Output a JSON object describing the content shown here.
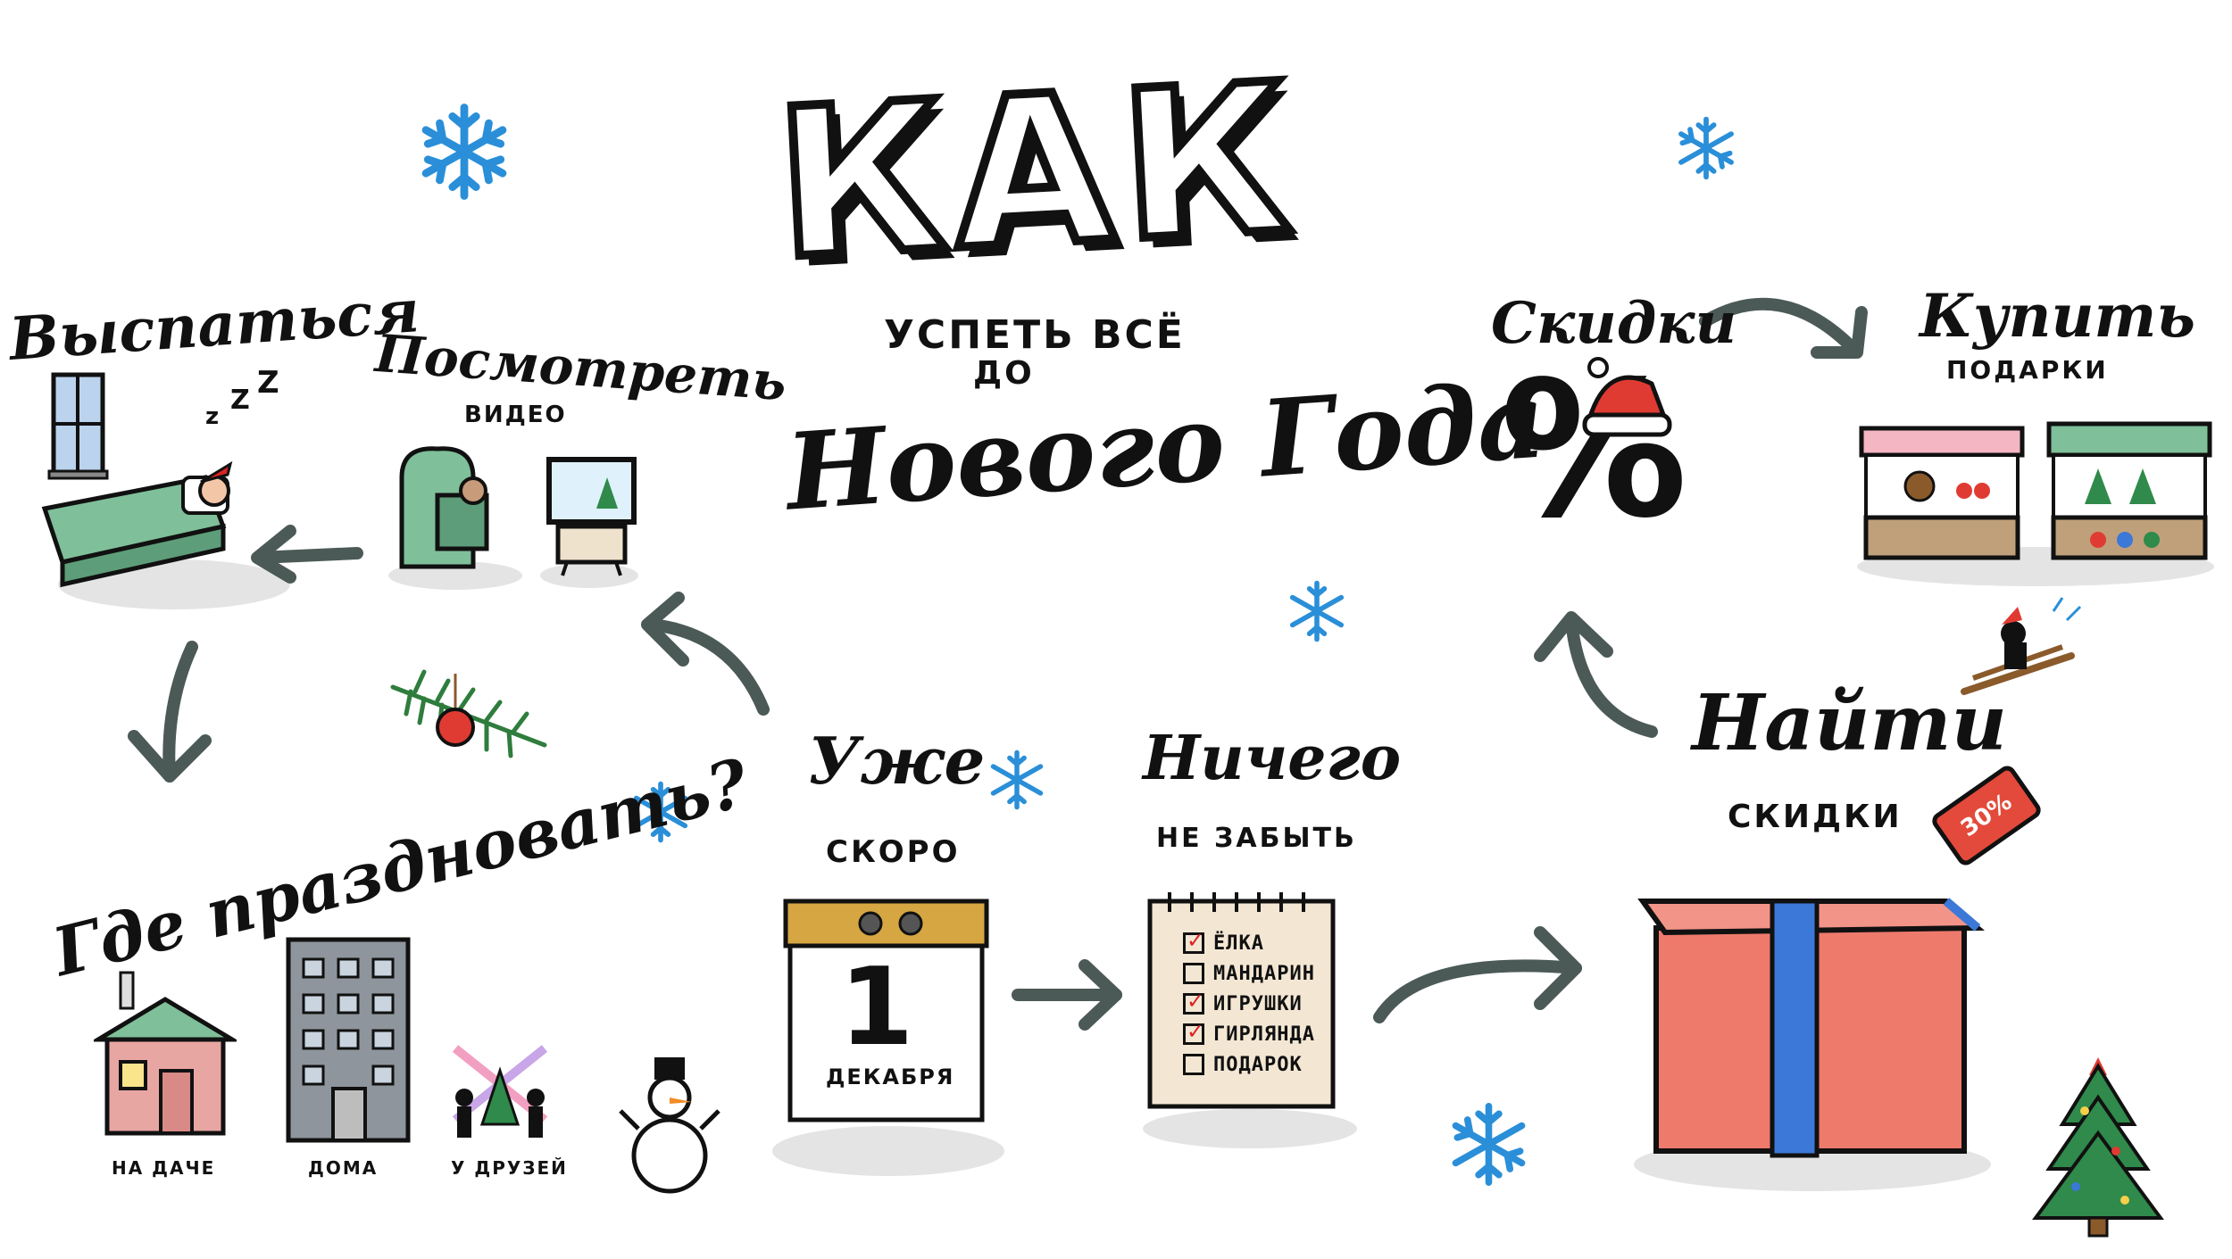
{
  "title": {
    "big": "КАК",
    "line2": "УСПЕТЬ ВСЁ",
    "line3": "ДО",
    "line4": "Нового Года"
  },
  "sections": {
    "sleep": {
      "label": "Выспаться"
    },
    "video": {
      "label": "Посмотреть",
      "sublabel": "ВИДЕО"
    },
    "where": {
      "label": "Где праздновать?",
      "options": [
        "НА ДАЧЕ",
        "ДОМА",
        "У ДРУЗЕЙ"
      ]
    },
    "soon": {
      "label": "Уже",
      "sublabel": "СКОРО"
    },
    "calendar": {
      "day": "1",
      "month": "ДЕКАБРЯ"
    },
    "nothing": {
      "label": "Ничего",
      "sublabel": "НЕ ЗАБЫТЬ"
    },
    "checklist": {
      "items": [
        {
          "text": "ЁЛКА",
          "checked": true
        },
        {
          "text": "МАНДАРИН",
          "checked": false
        },
        {
          "text": "ИГРУШКИ",
          "checked": true
        },
        {
          "text": "ГИРЛЯНДА",
          "checked": true
        },
        {
          "text": "ПОДАРОК",
          "checked": false
        }
      ]
    },
    "find": {
      "label": "Найти",
      "sublabel": "СКИДКИ"
    },
    "tag": {
      "text": "30%"
    },
    "discounts": {
      "label": "Скидки",
      "symbol": "%"
    },
    "buy": {
      "label": "Купить",
      "sublabel": "ПОДАРКИ"
    }
  },
  "colors": {
    "snowflake": "#2a8fd8",
    "arrow": "#4b5a57",
    "gift": "#ee7a6c",
    "ribbon": "#3b78d8",
    "green": "#7fbf99",
    "shadow": "#e4e4e4",
    "calendar_top": "#d6a642",
    "paper": "#f3e7d4"
  }
}
